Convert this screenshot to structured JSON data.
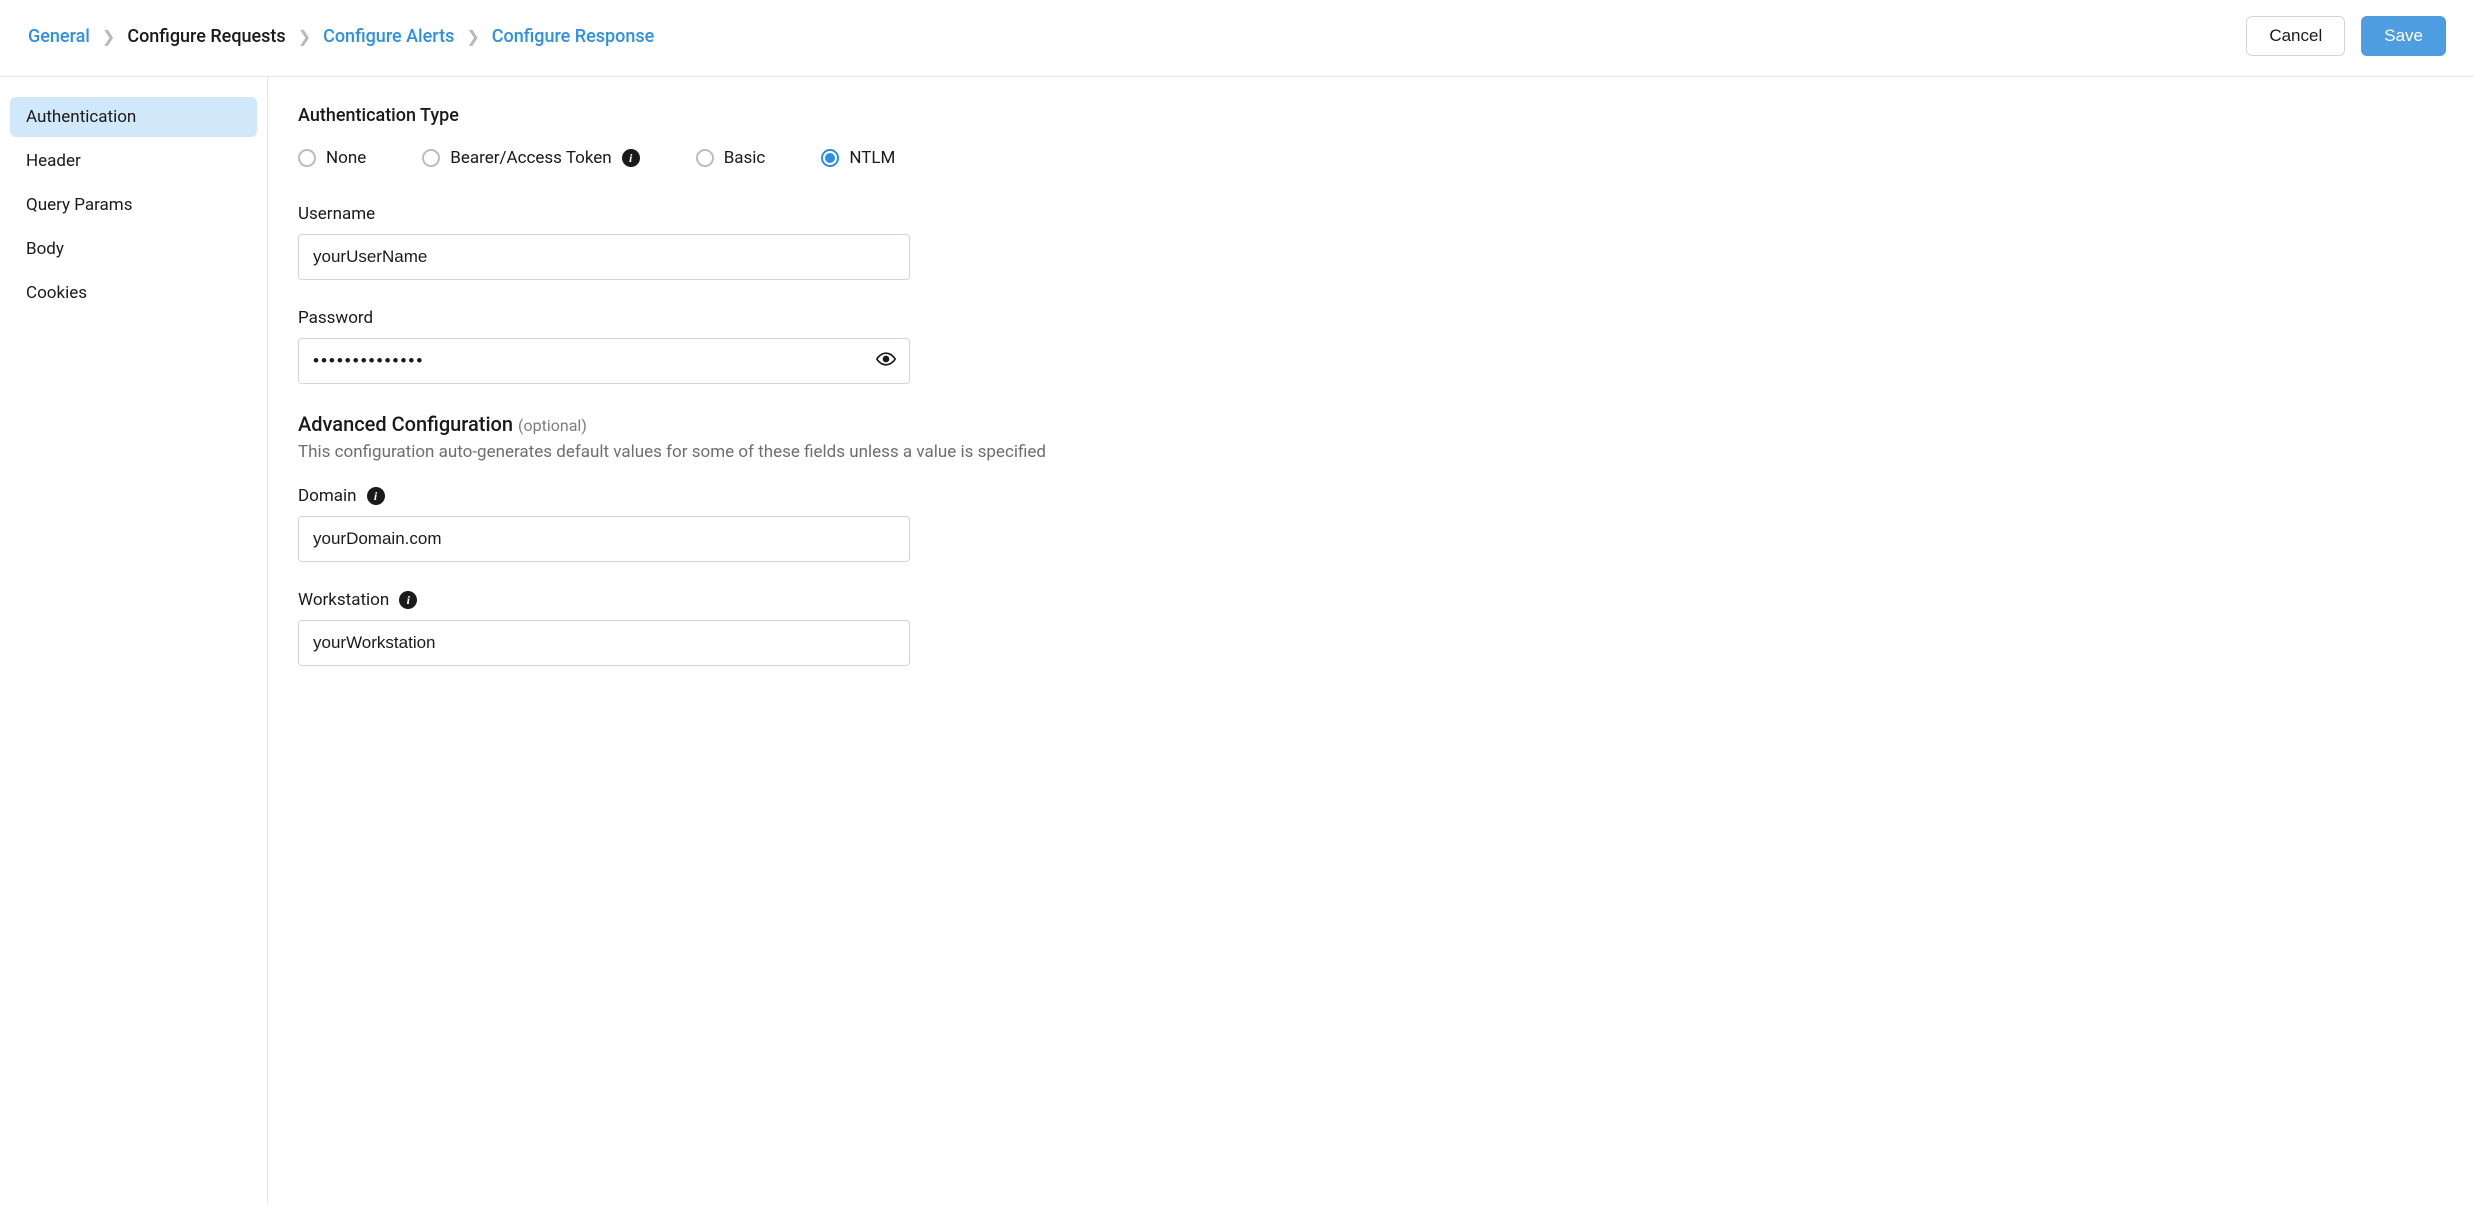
{
  "breadcrumb": {
    "items": [
      {
        "label": "General",
        "active": false
      },
      {
        "label": "Configure Requests",
        "active": true
      },
      {
        "label": "Configure Alerts",
        "active": false
      },
      {
        "label": "Configure Response",
        "active": false
      }
    ]
  },
  "actions": {
    "cancel": "Cancel",
    "save": "Save"
  },
  "sidebar": {
    "items": [
      {
        "label": "Authentication",
        "selected": true
      },
      {
        "label": "Header",
        "selected": false
      },
      {
        "label": "Query Params",
        "selected": false
      },
      {
        "label": "Body",
        "selected": false
      },
      {
        "label": "Cookies",
        "selected": false
      }
    ]
  },
  "authType": {
    "title": "Authentication Type",
    "options": [
      {
        "label": "None",
        "selected": false,
        "info": false
      },
      {
        "label": "Bearer/Access Token",
        "selected": false,
        "info": true
      },
      {
        "label": "Basic",
        "selected": false,
        "info": false
      },
      {
        "label": "NTLM",
        "selected": true,
        "info": false
      }
    ]
  },
  "fields": {
    "username": {
      "label": "Username",
      "value": "yourUserName"
    },
    "password": {
      "label": "Password",
      "value": "••••••••••••••"
    },
    "domain": {
      "label": "Domain",
      "value": "yourDomain.com"
    },
    "workstation": {
      "label": "Workstation",
      "value": "yourWorkstation"
    }
  },
  "advanced": {
    "title": "Advanced Configuration",
    "optional": "(optional)",
    "description": "This configuration auto-generates default values for some of these fields unless a value is specified"
  }
}
